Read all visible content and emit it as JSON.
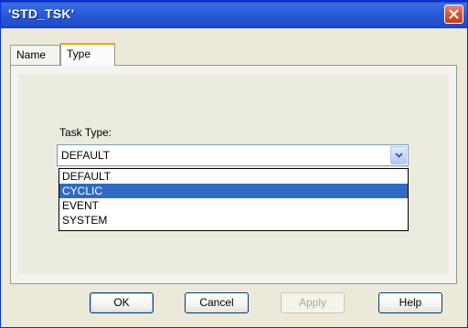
{
  "window": {
    "title": "'STD_TSK'"
  },
  "tabs": [
    {
      "label": "Name"
    },
    {
      "label": "Type"
    }
  ],
  "form": {
    "task_type_label": "Task Type:",
    "selected_value": "DEFAULT",
    "options": [
      "DEFAULT",
      "CYCLIC",
      "EVENT",
      "SYSTEM"
    ],
    "highlighted_option": "CYCLIC"
  },
  "buttons": {
    "ok": "OK",
    "cancel": "Cancel",
    "apply": "Apply",
    "help": "Help"
  },
  "icons": {
    "close": "close-icon",
    "dropdown": "chevron-down-icon"
  },
  "colors": {
    "titlebar": "#2a5ad7",
    "selection": "#316ac5",
    "close_button": "#d85a36"
  }
}
